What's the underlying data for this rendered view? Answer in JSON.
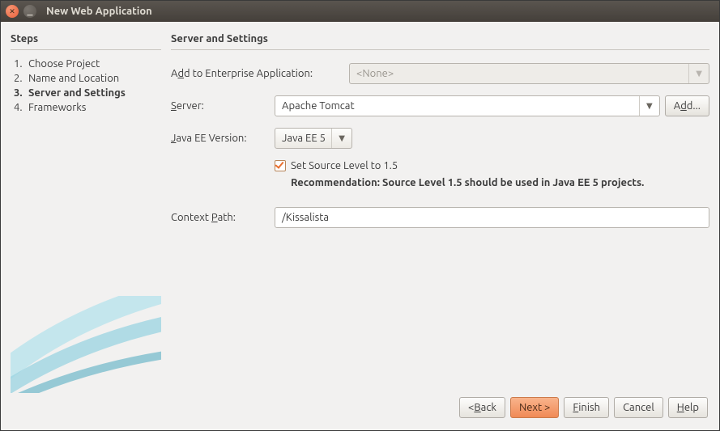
{
  "window": {
    "title": "New Web Application"
  },
  "sidebar": {
    "header": "Steps",
    "items": [
      {
        "num": "1.",
        "label": "Choose Project"
      },
      {
        "num": "2.",
        "label": "Name and Location"
      },
      {
        "num": "3.",
        "label": "Server and Settings"
      },
      {
        "num": "4.",
        "label": "Frameworks"
      }
    ],
    "active_index": 2
  },
  "main": {
    "header": "Server and Settings",
    "enterprise": {
      "label_pre": "A",
      "label_ul": "d",
      "label_post": "d to Enterprise Application:",
      "value": "<None>"
    },
    "server": {
      "label_ul": "S",
      "label_post": "erver:",
      "value": "Apache Tomcat",
      "add_pre": "A",
      "add_ul": "d",
      "add_post": "d..."
    },
    "javaee": {
      "label_ul": "J",
      "label_post": "ava EE Version:",
      "value": "Java EE 5"
    },
    "checkbox": {
      "checked": true,
      "label": "Set Source Level to 1.5"
    },
    "recommendation": "Recommendation: Source Level 1.5 should be used in Java EE 5 projects.",
    "context": {
      "label_pre": "Context ",
      "label_ul": "P",
      "label_post": "ath:",
      "value": "/Kissalista"
    }
  },
  "footer": {
    "back_pre": "< ",
    "back_ul": "B",
    "back_post": "ack",
    "next": "Next >",
    "finish_ul": "F",
    "finish_post": "inish",
    "cancel": "Cancel",
    "help_ul": "H",
    "help_post": "elp"
  }
}
